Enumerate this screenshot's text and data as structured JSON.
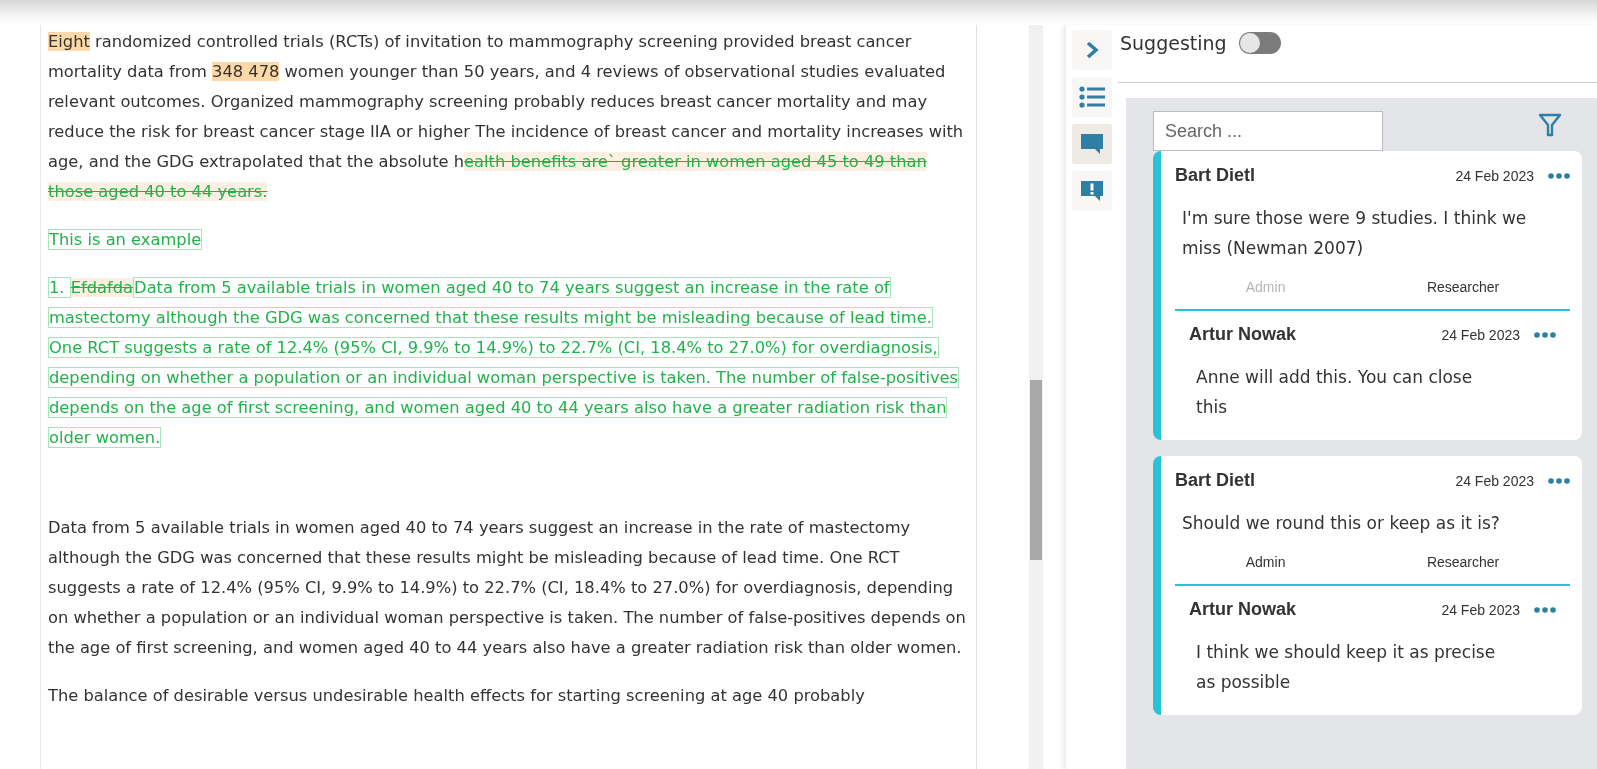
{
  "document": {
    "paragraphs": [
      {
        "segments": [
          {
            "kind": "highlight",
            "text": "Eight"
          },
          {
            "kind": "plain",
            "text": " randomized controlled trials (RCTs) of invitation to mammography screening provided breast cancer mortality data from "
          },
          {
            "kind": "highlight",
            "text": "348 478"
          },
          {
            "kind": "plain",
            "text": " women younger than 50 years, and 4 reviews of observational studies evaluated relevant outcomes. Organized mammography screening probably reduces breast cancer mortality and may reduce the risk for breast cancer stage IIA or higher The incidence of breast cancer and mortality increases with age, and the GDG extrapolated that the absolute h"
          },
          {
            "kind": "deleted",
            "text": "ealth benefits are` greater in women aged 45 to 49 than those aged 40 to 44 years."
          }
        ]
      },
      {
        "segments": [
          {
            "kind": "inserted",
            "text": "This is an example"
          }
        ]
      },
      {
        "segments": [
          {
            "kind": "inserted",
            "text": "1. "
          },
          {
            "kind": "deleted",
            "text": "Efdafda"
          },
          {
            "kind": "inserted",
            "text": "Data from 5 available trials in women aged 40 to 74 years suggest an increase in the rate of mastectomy although the GDG was concerned that these results might be misleading because of lead time. One RCT suggests a rate of 12.4% (95% CI, 9.9% to 14.9%) to 22.7% (CI, 18.4% to 27.0%) for overdiagnosis, depending on whether a population or an individual woman perspective is taken. The number of false-positives depends on the age of first screening, and women aged 40 to 44 years also have a greater radiation risk than older women."
          }
        ]
      },
      {
        "segments": [
          {
            "kind": "plain",
            "text": "Data from 5 available trials in women aged 40 to 74 years suggest an increase in the rate of mastectomy although the GDG was concerned that these results might be misleading because of lead time. One RCT suggests a rate of 12.4% (95% CI, 9.9% to 14.9%) to 22.7% (CI, 18.4% to 27.0%) for overdiagnosis, depending on whether a population or an individual woman perspective is taken. The number of false-positives depends on the age of first screening, and women aged 40 to 44 years also have a greater radiation risk than older women."
          }
        ]
      },
      {
        "segments": [
          {
            "kind": "plain",
            "text": "The balance of desirable versus undesirable health effects for starting screening at age 40 probably"
          }
        ]
      }
    ]
  },
  "sidebar": {
    "items": [
      {
        "kind": "collapse",
        "selected": false
      },
      {
        "kind": "outline",
        "selected": false
      },
      {
        "kind": "comments",
        "selected": true
      },
      {
        "kind": "issues",
        "selected": false
      }
    ]
  },
  "suggesting": {
    "label": "Suggesting",
    "on": false
  },
  "search": {
    "placeholder": "Search ..."
  },
  "threads": [
    {
      "author": "Bart Dietl",
      "date": "24 Feb 2023",
      "text": "I'm sure those were 9 studies. I think we miss (Newman 2007)",
      "roles": [
        {
          "label": "Admin",
          "faded": true
        },
        {
          "label": "Researcher",
          "faded": false
        }
      ],
      "reply": {
        "author": "Artur Nowak",
        "date": "24 Feb 2023",
        "text": "Anne will add this. You can close this"
      }
    },
    {
      "author": "Bart Dietl",
      "date": "24 Feb 2023",
      "text": "Should we round this or keep as it is?",
      "roles": [
        {
          "label": "Admin",
          "faded": false
        },
        {
          "label": "Researcher",
          "faded": false
        }
      ],
      "reply": {
        "author": "Artur Nowak",
        "date": "24 Feb 2023",
        "text": "I think we should keep it as precise as possible"
      }
    }
  ]
}
